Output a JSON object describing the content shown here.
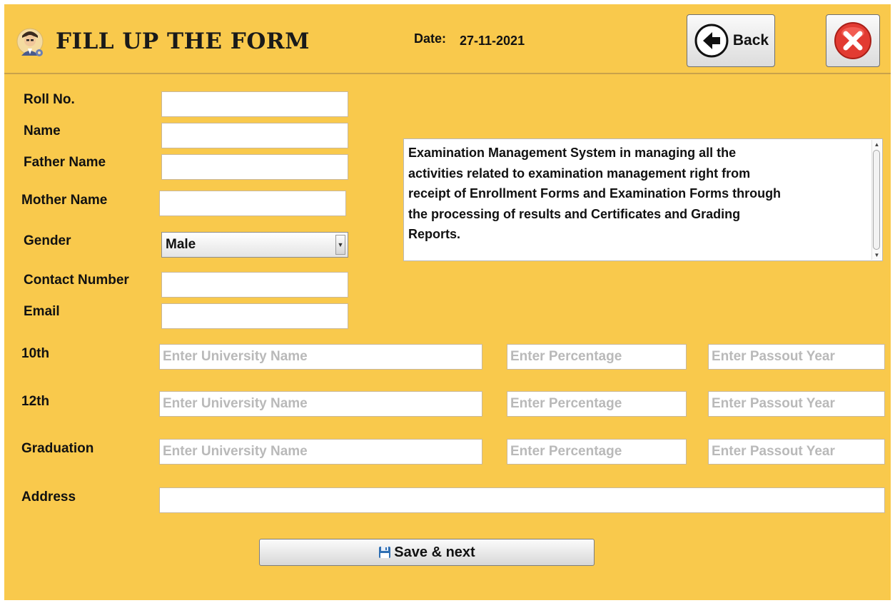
{
  "header": {
    "title": "FILL UP THE FORM",
    "date_label": "Date:",
    "date_value": "27-11-2021",
    "back_label": "Back",
    "logo_icon": "student-avatar-icon",
    "close_icon": "close-icon"
  },
  "form": {
    "roll_no_label": "Roll No.",
    "name_label": "Name",
    "father_name_label": "Father Name",
    "mother_name_label": "Mother Name",
    "gender_label": "Gender",
    "gender_value": "Male",
    "contact_label": "Contact Number",
    "email_label": "Email",
    "address_label": "Address"
  },
  "info": {
    "text": "Examination Management System in managing all the activities related to examination management right from receipt of Enrollment Forms and Examination Forms through the processing of results and Certificates and Grading Reports."
  },
  "education": {
    "placeholders": {
      "university": "Enter University Name",
      "percentage": "Enter Percentage",
      "year": "Enter Passout Year"
    },
    "rows": [
      {
        "label": "10th"
      },
      {
        "label": "12th"
      },
      {
        "label": "Graduation"
      }
    ]
  },
  "actions": {
    "save_next_label": "Save & next",
    "save_icon": "floppy-disk-icon"
  },
  "colors": {
    "background": "#f9c94c",
    "close_red": "#e23b32"
  }
}
